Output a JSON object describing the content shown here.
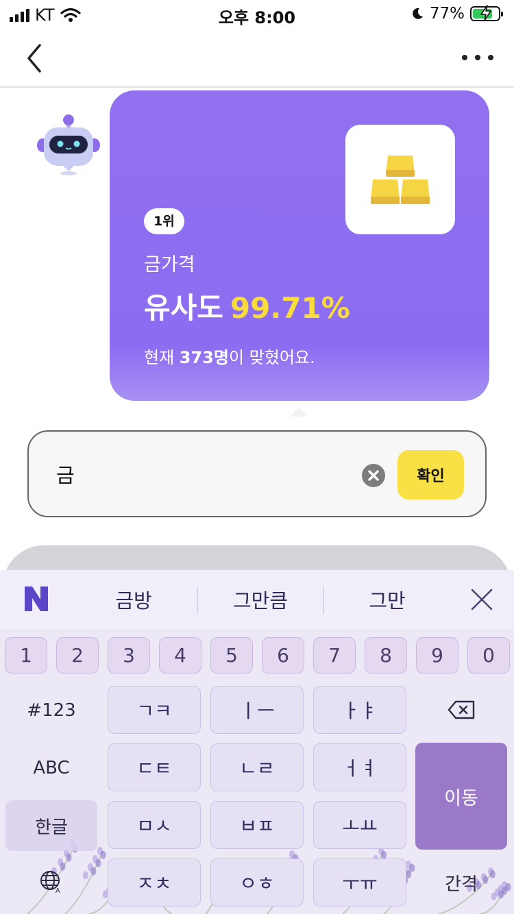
{
  "status_bar": {
    "carrier": "KT",
    "time": "오후 8:00",
    "battery": "77%",
    "battery_level": 0.77
  },
  "nav": {
    "back_icon": "chevron-left-icon",
    "more_icon": "more-horizontal-icon"
  },
  "card": {
    "image_icon": "gold-bars-icon",
    "rank": "1위",
    "label": "금가격",
    "similarity_label": "유사도",
    "similarity_value": "99.71%",
    "count_prefix": "현재 ",
    "count": "373명",
    "count_suffix": "이 맞혔어요."
  },
  "input": {
    "value": "금",
    "confirm_label": "확인"
  },
  "keyboard": {
    "suggestions": [
      "금방",
      "그만큼",
      "그만"
    ],
    "numbers": [
      "1",
      "2",
      "3",
      "4",
      "5",
      "6",
      "7",
      "8",
      "9",
      "0"
    ],
    "left_keys": {
      "sym": "#123",
      "abc": "ABC",
      "hangul": "한글"
    },
    "letter_keys": [
      "ㄱㅋ",
      "ㅣㅡ",
      "ㅏㅑ",
      "ㄷㅌ",
      "ㄴㄹ",
      "ㅓㅕ",
      "ㅁㅅ",
      "ㅂㅍ",
      "ㅗㅛ",
      "ㅈㅊ",
      "ㅇㅎ",
      "ㅜㅠ"
    ],
    "move_label": "이동",
    "space_label": "간격",
    "accent": "#9a7ac8"
  }
}
